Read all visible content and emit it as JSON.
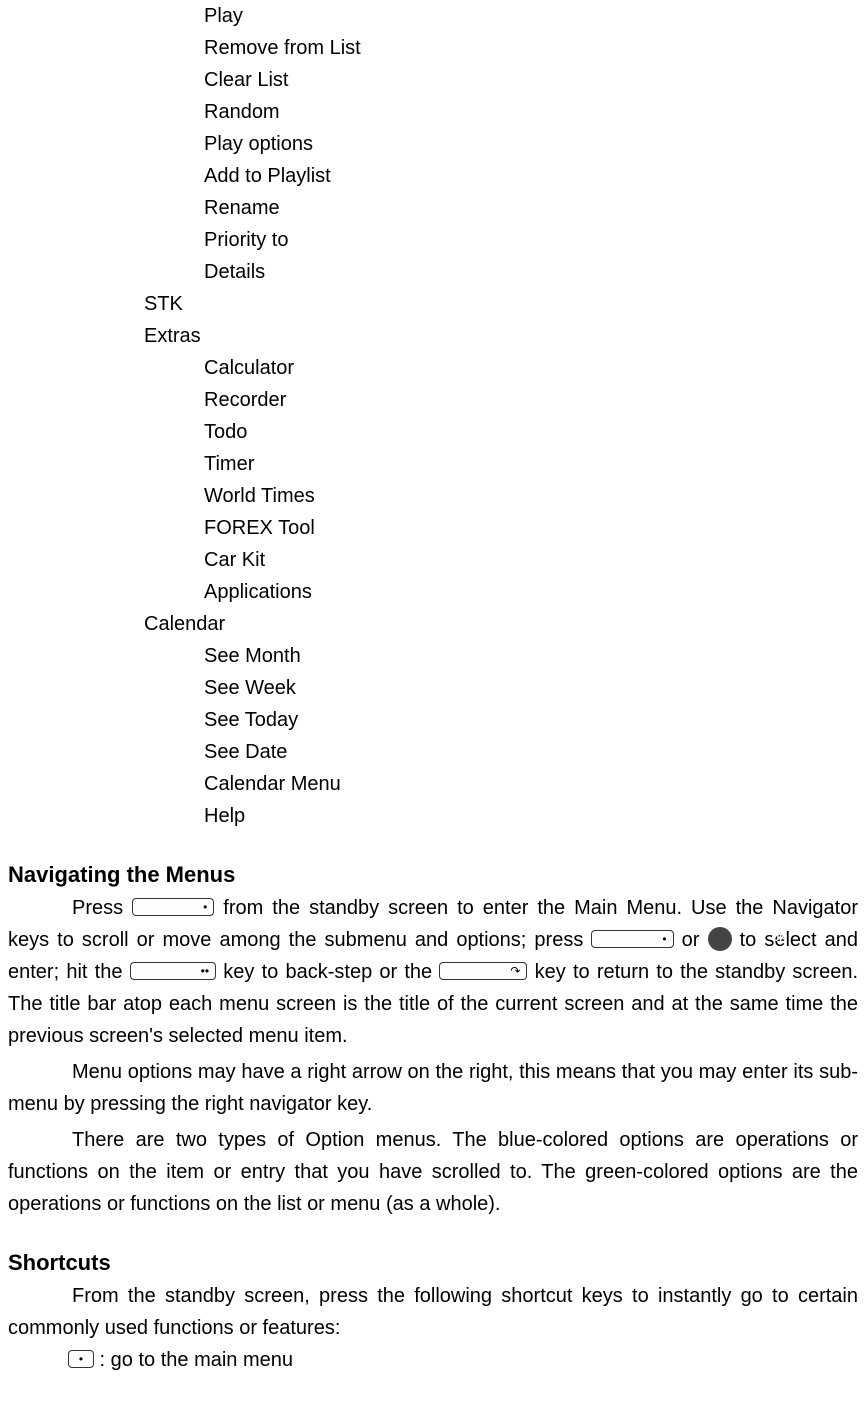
{
  "menu": {
    "group1": {
      "items": [
        "Play",
        "Remove from List",
        "Clear List",
        "Random",
        "Play options",
        "Add to Playlist",
        "Rename",
        "Priority to",
        "Details"
      ]
    },
    "stk": "STK",
    "extras": {
      "label": "Extras",
      "items": [
        "Calculator",
        "Recorder",
        "Todo",
        "Timer",
        "World Times",
        "FOREX Tool",
        "Car Kit",
        "Applications"
      ]
    },
    "calendar": {
      "label": "Calendar",
      "items": [
        "See Month",
        "See Week",
        "See Today",
        "See Date",
        "Calendar Menu",
        "Help"
      ]
    }
  },
  "nav": {
    "heading": "Navigating the Menus",
    "p1a": "Press ",
    "p1b": " from the standby screen to enter the Main Menu. Use the Navigator keys to scroll or move among the submenu and options; press ",
    "p1c": " or ",
    "p1d": " to select and enter; hit the ",
    "p1e": " key to back-step or the ",
    "p1f": " key to return to the standby screen. The title bar atop each menu screen is the title of the current screen and at the same time the previous screen's selected menu item.",
    "p2": "Menu options may have a right arrow on the right, this means that you may enter its sub-menu by pressing the right navigator key.",
    "p3": "There are two types of Option menus. The blue-colored options are operations or functions on the item or entry that you have scrolled to. The green-colored options are the operations or functions on the list or menu (as a whole)."
  },
  "shortcuts": {
    "heading": "Shortcuts",
    "p1": "From the standby screen, press the following shortcut keys to instantly go to certain commonly used functions or features:",
    "line1": "  : go to the main menu"
  },
  "icons": {
    "dot": "•",
    "twodot": "••",
    "ok": "OK",
    "end": "↷"
  }
}
